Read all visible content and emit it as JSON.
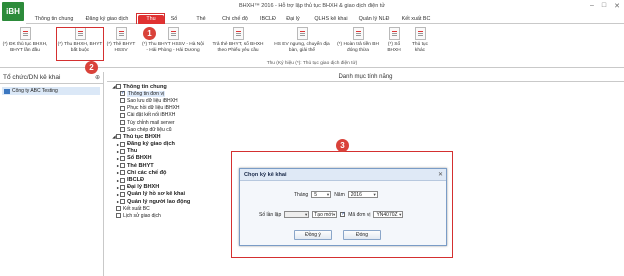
{
  "app": {
    "logo_text": "iBH",
    "title": "BHXH™ 2016 - Hỗ trợ lập thủ tục BHXH & giao dịch điện tử"
  },
  "window": {
    "minimize": "–",
    "maximize": "□",
    "close": "✕"
  },
  "menu_tabs": [
    "Thông tin chung",
    "Đăng ký giao dịch",
    "Thu",
    "Sổ",
    "Thẻ",
    "Chi chế độ",
    "IBCLĐ",
    "Đại lý",
    "QLHS kê khai",
    "Quản lý NLĐ",
    "Kết xuất BC"
  ],
  "ribbon": {
    "buttons": [
      "(*) ĐK thủ tục BHXH, BHYT lần đầu",
      "(*) Thu BHXH, BHYT bắt buộc",
      "(*) Thẻ BHYT HSSV",
      "(*) Thu BHYT HSSV - Hà Nội - Hải Phòng - Hải Dương",
      "Trả thẻ BHYT, sổ BHXH theo Phiếu yêu cầu",
      "HS EV ngưng, chuyển địa bàn, giải thể",
      "(*) Hoàn trả tiền BH đóng thừa",
      "(*) Sổ BHXH",
      "Thủ tục khác"
    ],
    "caption": "Thu (Ký hiệu (*): Thủ tục giao dịch điện tử)"
  },
  "badges": {
    "one": "1",
    "two": "2",
    "three": "3"
  },
  "left_panel": {
    "header": "Tổ chức/DN kê khai",
    "pin": "⊕",
    "org": "Công ty ABC Testing"
  },
  "main": {
    "header": "Danh mục tính năng",
    "tree_general": {
      "title": "Thông tin chung",
      "items": [
        "Thông tin đơn vị",
        "Sao lưu dữ liệu iBHXH",
        "Phục hồi dữ liệu iBHXH",
        "Cài đặt kết nối iBHXH",
        "Tùy chỉnh mail server",
        "Sao chép dữ liệu cũ"
      ]
    },
    "tree_procedures": {
      "title": "Thủ tục BHXH",
      "items": [
        "Đăng ký giao dịch",
        "Thu",
        "Sổ BHXH",
        "Thẻ BHYT",
        "Chi các chế độ",
        "IBCLĐ",
        "Đại lý BHXH",
        "Quản lý hồ sơ kê khai",
        "Quản lý người lao động"
      ]
    },
    "tree_bottom": [
      "Kết xuất BC",
      "Lịch sử giao dịch"
    ]
  },
  "dialog": {
    "title": "Chọn kỳ kê khai",
    "close": "✕",
    "month_label": "Tháng",
    "month_value": "5",
    "year_label": "Năm",
    "year_value": "2016",
    "count_label": "Số lần lập",
    "count_value": "",
    "new_label": "Tạo mới",
    "unit_label": "Mã đơn vị",
    "unit_value": "YN4070Z",
    "ok_label": "Đồng ý",
    "close_label": "Đóng"
  }
}
